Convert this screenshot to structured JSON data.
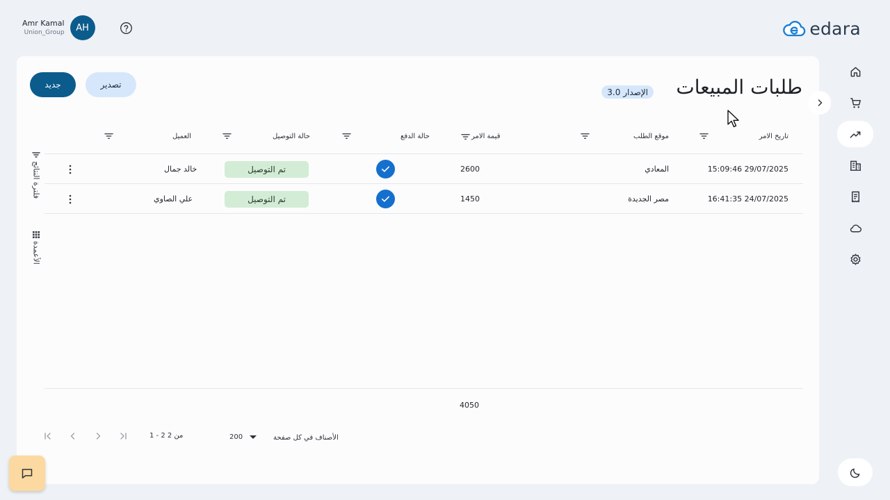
{
  "header": {
    "user_name": "Amr Kamal",
    "user_org": "Union_Group",
    "avatar_initials": "AH",
    "logo_text": "edara"
  },
  "colors": {
    "primary": "#0b5c8c",
    "accent_light": "#d6e7fb",
    "status_green_bg": "#d3ecd6",
    "check_blue": "#1570cd",
    "chat_fab": "#fcd9a0"
  },
  "rail": {
    "items": [
      {
        "icon": "home-icon"
      },
      {
        "icon": "cart-icon"
      },
      {
        "icon": "trending-up-icon",
        "active": true
      },
      {
        "icon": "building-icon"
      },
      {
        "icon": "receipt-icon"
      },
      {
        "icon": "cloud-icon"
      },
      {
        "icon": "gear-icon"
      }
    ],
    "theme_icon": "moon-icon"
  },
  "page": {
    "title": "طلبات المبيعات",
    "version": "الإصدار 3.0",
    "new_button": "جديد",
    "export_button": "تصدير",
    "filter_tool_label": "فلترة النتائج",
    "columns_tool_label": "الأعمدة"
  },
  "table": {
    "headers": {
      "order_date": "تاريخ الامر",
      "order_location": "موقع الطلب",
      "order_value": "قيمة الامر",
      "payment_status": "حالة الدفع",
      "delivery_status": "حالة التوصيل",
      "customer": "العميل"
    },
    "rows": [
      {
        "order_date": "15:09:46 29/07/2025",
        "order_location": "المعادي",
        "order_value": "2600",
        "payment_paid": true,
        "delivery_status": "تم التوصيل",
        "customer": "خالد جمال"
      },
      {
        "order_date": "16:41:35 24/07/2025",
        "order_location": "مصر الجديدة",
        "order_value": "1450",
        "payment_paid": true,
        "delivery_status": "تم التوصيل",
        "customer": "علي الصاوي"
      }
    ],
    "total": "4050"
  },
  "pagination": {
    "range": "1 - 2 من 2",
    "page_size": "200",
    "page_size_label": "الأصناف في كل صفحة"
  }
}
